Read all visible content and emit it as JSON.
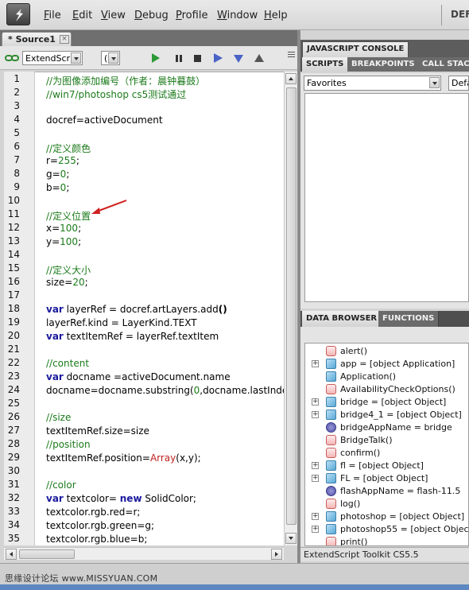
{
  "menubar": {
    "items": [
      "File",
      "Edit",
      "View",
      "Debug",
      "Profile",
      "Window",
      "Help"
    ],
    "workspace_label": "DEF"
  },
  "document_tab": {
    "label": "* Source1",
    "close": "×"
  },
  "toolbar": {
    "target_app": "ExtendScri",
    "engine": "("
  },
  "editor": {
    "lines": [
      "1",
      "2",
      "3",
      "4",
      "5",
      "6",
      "7",
      "8",
      "9",
      "10",
      "11",
      "12",
      "13",
      "14",
      "15",
      "16",
      "17",
      "18",
      "19",
      "20",
      "21",
      "22",
      "23",
      "24",
      "25",
      "26",
      "27",
      "28",
      "29",
      "30",
      "31",
      "32",
      "33",
      "34",
      "35"
    ],
    "code": [
      "//为图像添加编号（作者：晨钟暮鼓）",
      "//win7/photoshop cs5测试通过",
      "",
      "docref=activeDocument",
      "",
      "//定义颜色",
      "r=255;",
      "g=0;",
      "b=0;",
      "",
      "//定义位置",
      "x=100;",
      "y=100;",
      "",
      "//定义大小",
      "size=20;",
      "",
      "var layerRef = docref.artLayers.add()",
      "layerRef.kind = LayerKind.TEXT",
      "var textItemRef = layerRef.textItem",
      "",
      "//content",
      "var docname =activeDocument.name",
      "docname=docname.substring(0,docname.lastIndexO",
      "",
      "//size",
      "textItemRef.size=size",
      "//position",
      "textItemRef.position=Array(x,y);",
      "",
      "//color",
      "var textcolor= new SolidColor;",
      "textcolor.rgb.red=r;",
      "textcolor.rgb.green=g;",
      "textcolor.rgb.blue=b;"
    ]
  },
  "console_panel": {
    "tab": "JAVASCRIPT CONSOLE",
    "subtabs": [
      "SCRIPTS",
      "BREAKPOINTS",
      "CALL STACK"
    ],
    "favorites": "Favorites",
    "default": "Defa"
  },
  "data_panel": {
    "tabs": [
      "DATA BROWSER",
      "FUNCTIONS"
    ],
    "items": [
      {
        "icon": "function",
        "expand": false,
        "label": "alert()"
      },
      {
        "icon": "object",
        "expand": true,
        "label": "app = [object Application]"
      },
      {
        "icon": "object",
        "expand": false,
        "label": "Application()"
      },
      {
        "icon": "function",
        "expand": false,
        "label": "AvailabilityCheckOptions()"
      },
      {
        "icon": "object",
        "expand": true,
        "label": "bridge = [object Object]"
      },
      {
        "icon": "object",
        "expand": true,
        "label": "bridge4_1 = [object Object]"
      },
      {
        "icon": "string",
        "expand": false,
        "label": "bridgeAppName = bridge"
      },
      {
        "icon": "function",
        "expand": false,
        "label": "BridgeTalk()"
      },
      {
        "icon": "function",
        "expand": false,
        "label": "confirm()"
      },
      {
        "icon": "object",
        "expand": true,
        "label": "fl = [object Object]"
      },
      {
        "icon": "object",
        "expand": true,
        "label": "FL = [object Object]"
      },
      {
        "icon": "string",
        "expand": false,
        "label": "flashAppName = flash-11.5"
      },
      {
        "icon": "function",
        "expand": false,
        "label": "log()"
      },
      {
        "icon": "object",
        "expand": true,
        "label": "photoshop = [object Object]"
      },
      {
        "icon": "object",
        "expand": true,
        "label": "photoshop55 = [object Object]"
      },
      {
        "icon": "function",
        "expand": false,
        "label": "print()"
      }
    ]
  },
  "status": {
    "text": "ExtendScript Toolkit CS5.5"
  },
  "watermark": "思缘设计论坛 www.MISSYUAN.COM"
}
